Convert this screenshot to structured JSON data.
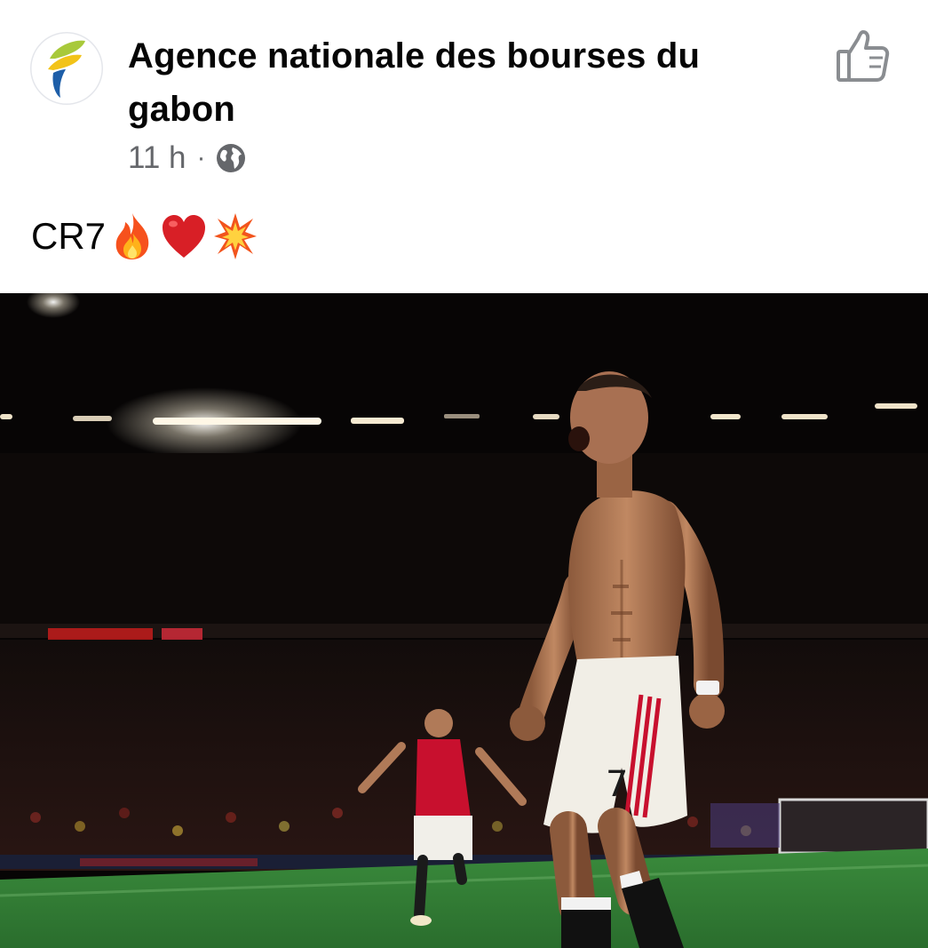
{
  "post": {
    "author": "Agence nationale des bourses du gabon",
    "time": "11 h",
    "separator": "·",
    "privacy_icon": "globe-icon",
    "reaction_icon": "thumbs-up-icon",
    "caption_text": "CR7",
    "caption_emojis": [
      "fire-emoji",
      "red-heart-emoji",
      "collision-emoji"
    ],
    "photo": {
      "subject": "celebrating-footballer",
      "kit_number": "7"
    }
  },
  "colors": {
    "name": "#050505",
    "meta": "#65676b",
    "icon_gray": "#8a8d91",
    "pitch": "#2f7a33",
    "kit_red": "#c8102e"
  }
}
